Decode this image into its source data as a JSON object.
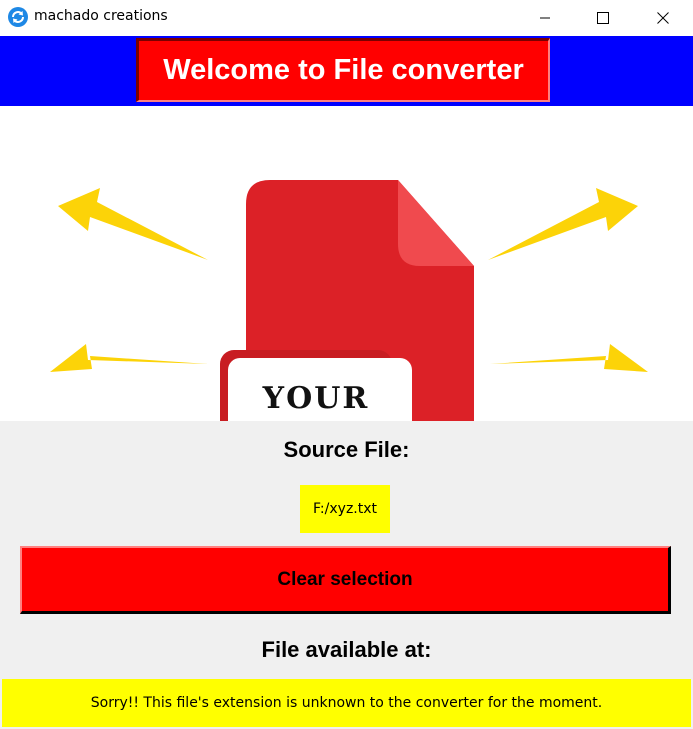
{
  "window": {
    "title": "machado creations",
    "app_icon": "refresh-icon",
    "controls": [
      "minimize-icon",
      "maximize-icon",
      "close-icon"
    ]
  },
  "header": {
    "title": "Welcome to File converter",
    "background_color": "#0000ff",
    "title_box_color": "#ff0000"
  },
  "illustration": {
    "document_text": "YOUR",
    "document_color": "#dc2127",
    "arrow_color": "#fcd308"
  },
  "source": {
    "label": "Source File:",
    "file_path": "F:/xyz.txt"
  },
  "actions": {
    "clear_label": "Clear selection"
  },
  "output": {
    "label": "File available at:",
    "message": "Sorry!! This file's extension is unknown to the converter for the moment."
  }
}
